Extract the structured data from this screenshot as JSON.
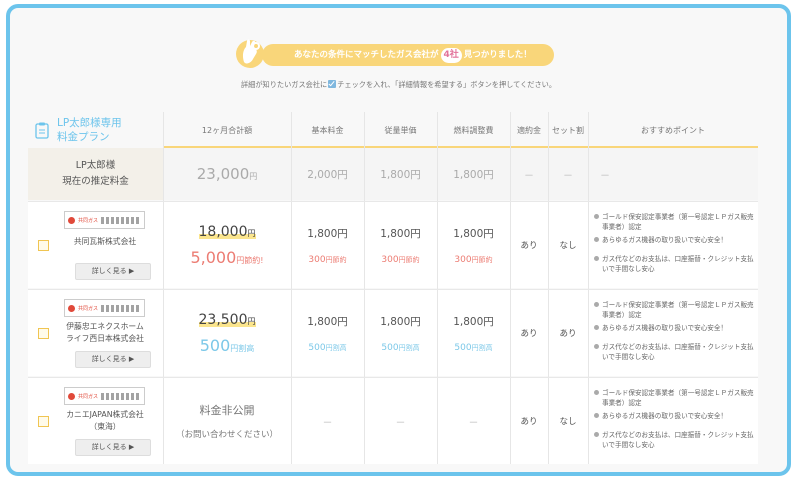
{
  "banner": {
    "text_before": "あなたの条件にマッチしたガス会社が",
    "count": "4社",
    "text_after": "見つかりました！",
    "icon": "ok-hand-icon"
  },
  "instruction": {
    "before": "詳細が知りたいガス会社に",
    "after": "チェックを入れ、「詳細情報を希望する」ボタンを押してください。"
  },
  "table": {
    "title_line1": "LP太郎様専用",
    "title_line2": "料金プラン",
    "headers": [
      "12ヶ月合計額",
      "基本料金",
      "従量単価",
      "燃料調整費",
      "適約金",
      "セット割",
      "おすすめポイント"
    ],
    "estimate": {
      "label_line1": "LP太郎様",
      "label_line2": "現在の推定料金",
      "total": "23,000",
      "total_unit": "円",
      "base": "2,000円",
      "unit_price": "1,800円",
      "fuel": "1,800円",
      "penalty": "－",
      "set": "－",
      "points": "－"
    },
    "rows": [
      {
        "logo_name": "共同ガス",
        "company_line1": "共同瓦斯株式会社",
        "company_line2": "",
        "detail_label": "詳しく見る ▶",
        "total": "18,000",
        "total_unit": "円",
        "saving": "5,000",
        "saving_unit": "円節約!",
        "saving_type": "red",
        "base": "1,800円",
        "base_sub": "300",
        "base_sub_unit": "円節約",
        "unit_price": "1,800円",
        "unit_price_sub": "300",
        "unit_price_sub_unit": "円節約",
        "fuel": "1,800円",
        "fuel_sub": "300",
        "fuel_sub_unit": "円節約",
        "penalty": "あり",
        "set": "なし",
        "points": [
          "ゴールド保安認定事業者（第一号認定ＬＰガス販売事業者）認定",
          "あらゆるガス機器の取り扱いで安心安全！",
          "ガス代などのお支払は、口座振替・クレジット支払いで手間なし安心"
        ]
      },
      {
        "logo_name": "共同ガス",
        "company_line1": "伊藤忠エネクスホーム",
        "company_line2": "ライフ西日本株式会社",
        "detail_label": "詳しく見る ▶",
        "total": "23,500",
        "total_unit": "円",
        "saving": "500",
        "saving_unit": "円割高",
        "saving_type": "blue",
        "base": "1,800円",
        "base_sub": "500",
        "base_sub_unit": "円割高",
        "unit_price": "1,800円",
        "unit_price_sub": "500",
        "unit_price_sub_unit": "円割高",
        "fuel": "1,800円",
        "fuel_sub": "500",
        "fuel_sub_unit": "円割高",
        "penalty": "あり",
        "set": "あり",
        "points": [
          "ゴールド保安認定事業者（第一号認定ＬＰガス販売事業者）認定",
          "あらゆるガス機器の取り扱いで安心安全！",
          "ガス代などのお支払は、口座振替・クレジット支払いで手間なし安心"
        ]
      },
      {
        "logo_name": "共同ガス",
        "company_line1": "カニエJAPAN株式会社",
        "company_line2": "（東海）",
        "detail_label": "詳しく見る ▶",
        "undisclosed": "料金非公開",
        "undisclosed_sub": "（お問い合わせください）",
        "base": "－",
        "unit_price": "－",
        "fuel": "－",
        "penalty": "あり",
        "set": "なし",
        "points": [
          "ゴールド保安認定事業者（第一号認定ＬＰガス販売事業者）認定",
          "あらゆるガス機器の取り扱いで安心安全！",
          "ガス代などのお支払は、口座振替・クレジット支払いで手間なし安心"
        ]
      }
    ]
  },
  "colors": {
    "frame": "#6cc4ec",
    "banner": "#f9d67a",
    "saving_red": "#ec7c73",
    "saving_blue": "#7cc8e8"
  }
}
